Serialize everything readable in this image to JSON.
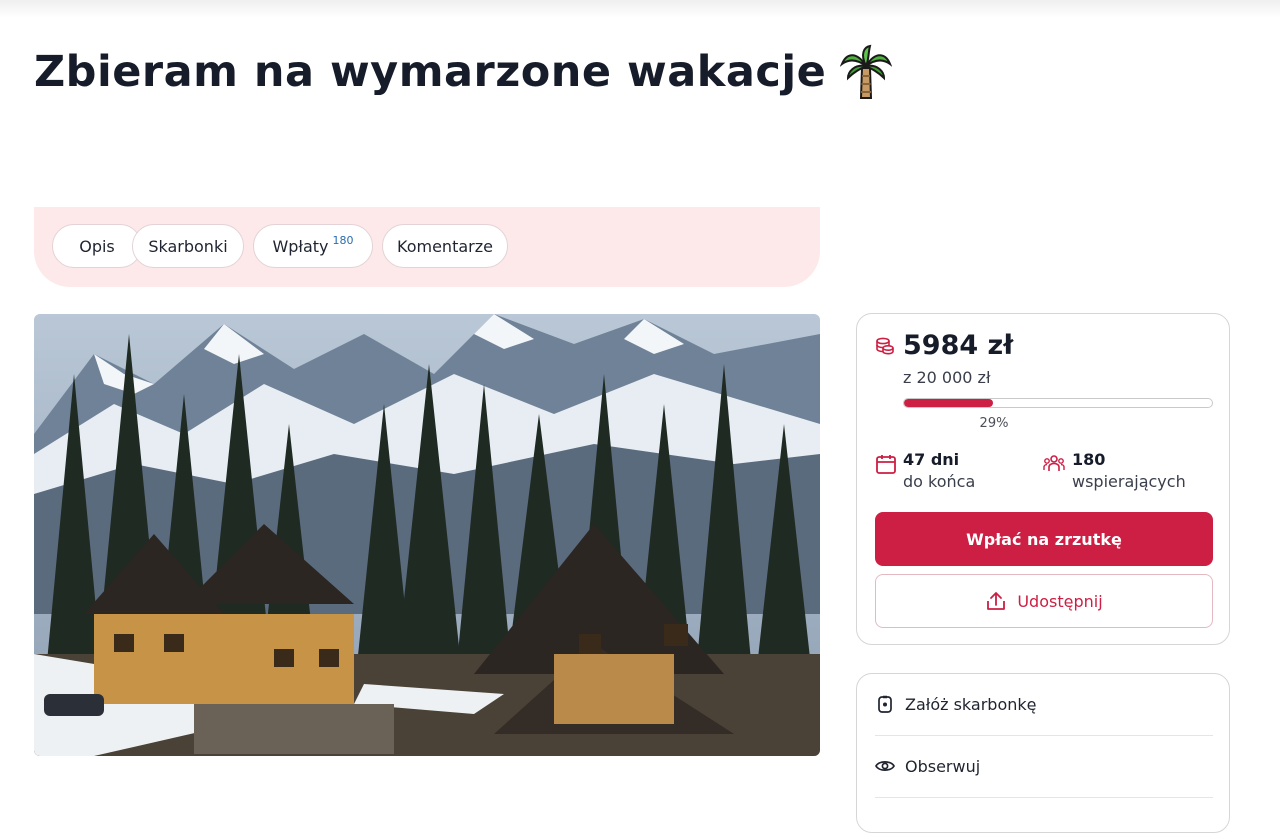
{
  "page": {
    "title": "Zbieram na wymarzone wakacje",
    "title_emoji_icon": "palm-tree-icon"
  },
  "tabs": [
    {
      "label": "Opis"
    },
    {
      "label": "Skarbonki"
    },
    {
      "label": "Wpłaty",
      "badge": "180"
    },
    {
      "label": "Komentarze"
    }
  ],
  "campaign": {
    "amount": "5984 zł",
    "goal": "z 20 000 zł",
    "progress_fraction": 0.29,
    "progress_label": "29%",
    "days_value": "47 dni",
    "days_label": "do końca",
    "supporters_value": "180",
    "supporters_label": "wspierających",
    "pay_button": "Wpłać na zrzutkę",
    "share_button": "Udostępnij"
  },
  "actions": [
    {
      "label": "Załóż skarbonkę",
      "icon": "piggy-bank-icon"
    },
    {
      "label": "Obserwuj",
      "icon": "eye-icon"
    }
  ],
  "colors": {
    "accent": "#cc1f43",
    "tabs_background": "#fde8ea",
    "title_text": "#161c2a"
  },
  "image": {
    "description_icon": "mountain-cabin-photo"
  }
}
